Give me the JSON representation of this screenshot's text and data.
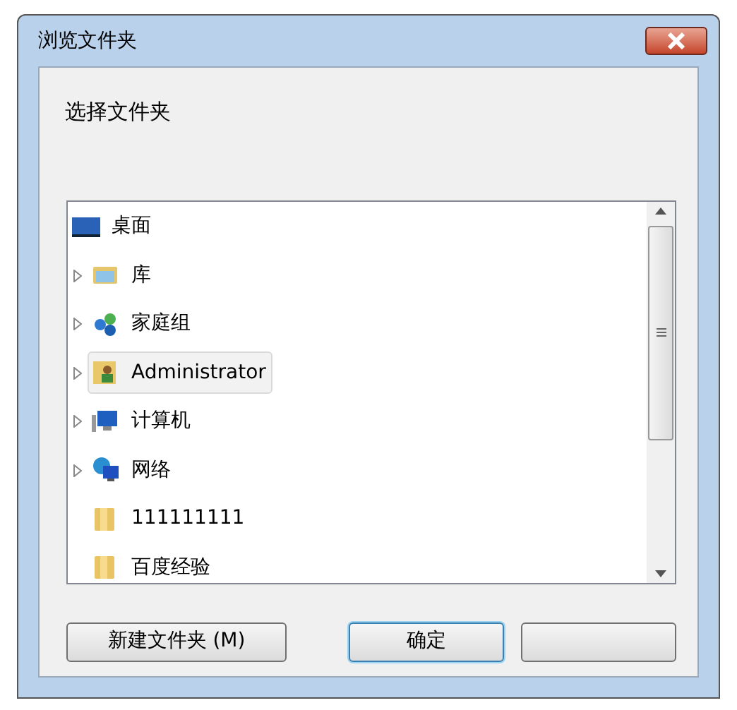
{
  "window": {
    "title": "浏览文件夹"
  },
  "prompt": "选择文件夹",
  "tree": [
    {
      "label": "桌面",
      "kind": "desktop",
      "selected": false,
      "children": [
        {
          "label": "库",
          "kind": "library",
          "expandable": true,
          "selected": false
        },
        {
          "label": "家庭组",
          "kind": "homegroup",
          "expandable": true,
          "selected": false
        },
        {
          "label": "Administrator",
          "kind": "user",
          "expandable": true,
          "selected": true
        },
        {
          "label": "计算机",
          "kind": "computer",
          "expandable": true,
          "selected": false
        },
        {
          "label": "网络",
          "kind": "network",
          "expandable": true,
          "selected": false
        },
        {
          "label": "111111111",
          "kind": "folder",
          "expandable": false,
          "selected": false
        },
        {
          "label": "百度经验",
          "kind": "folder",
          "expandable": false,
          "selected": false
        }
      ]
    }
  ],
  "buttons": [
    {
      "kind": "text",
      "label": "新建文件夹 (M)",
      "default": false
    },
    {
      "kind": "text",
      "label": "确定",
      "default": true
    },
    {
      "kind": "blank",
      "default": false
    }
  ]
}
